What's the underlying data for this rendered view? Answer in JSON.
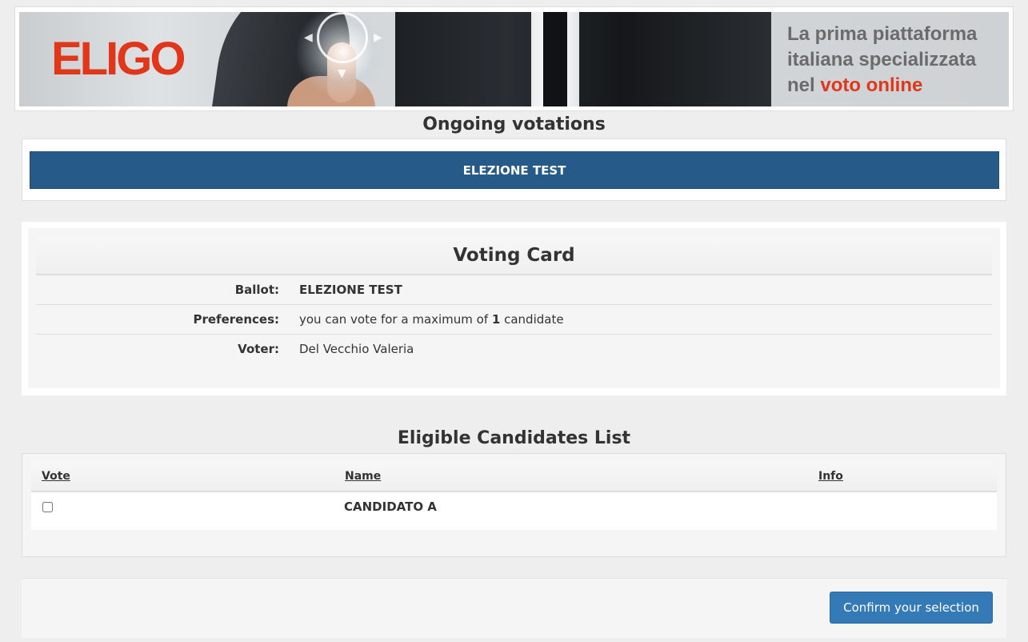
{
  "banner": {
    "logo_text": "ELIGO",
    "tagline_line1": "La prima piattaforma",
    "tagline_line2": "italiana specializzata",
    "tagline_line3_prefix": "nel ",
    "tagline_line3_highlight": "voto online"
  },
  "ongoing": {
    "title": "Ongoing votations",
    "items": [
      {
        "label": "ELEZIONE TEST"
      }
    ]
  },
  "voting_card": {
    "title": "Voting Card",
    "rows": [
      {
        "label": "Ballot:",
        "value": "ELEZIONE TEST"
      },
      {
        "label": "Preferences:",
        "value_prefix": "you can vote for a maximum of ",
        "value_count": "1",
        "value_suffix": " candidate"
      },
      {
        "label": "Voter:",
        "value": "Del Vecchio Valeria"
      }
    ]
  },
  "candidates": {
    "title": "Eligible Candidates List",
    "columns": [
      "Vote",
      "Name",
      "Info"
    ],
    "rows": [
      {
        "name": "CANDIDATO A",
        "checked": false,
        "info": ""
      }
    ]
  },
  "footer": {
    "confirm_label": "Confirm your selection"
  },
  "colors": {
    "banner_accent": "#e0371a",
    "votation_bar": "#265a88",
    "primary_button": "#337ab7"
  }
}
